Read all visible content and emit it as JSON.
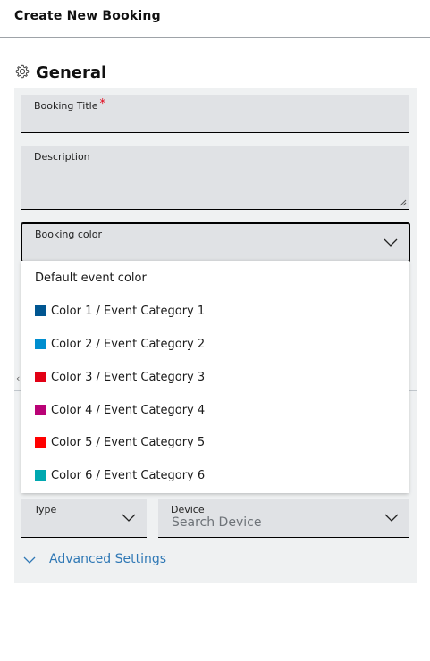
{
  "header": {
    "title": "Create New Booking"
  },
  "section": {
    "title": "General",
    "icon": "gear-icon"
  },
  "fields": {
    "booking_title": {
      "label": "Booking Title",
      "required_mark": "*"
    },
    "description": {
      "label": "Description"
    },
    "booking_color": {
      "label": "Booking color"
    },
    "type": {
      "label": "Type"
    },
    "device": {
      "label": "Device",
      "placeholder": "Search Device"
    }
  },
  "color_options": [
    {
      "label": "Default event color"
    },
    {
      "label": "Color 1 / Event Category 1",
      "color": "#005691"
    },
    {
      "label": "Color 2 / Event Category 2",
      "color": "#008ecf"
    },
    {
      "label": "Color 3 / Event Category 3",
      "color": "#e20015"
    },
    {
      "label": "Color 4 / Event Category 4",
      "color": "#b90276"
    },
    {
      "label": "Color 5 / Event Category 5",
      "color": "#ff0000"
    },
    {
      "label": "Color 6 / Event Category 6",
      "color": "#00a8b0"
    }
  ],
  "advanced": {
    "label": "Advanced Settings"
  },
  "colors": {
    "accent": "#2f78b5",
    "field_bg": "#e0e2e5",
    "panel_bg": "#eff1f2",
    "required": "#e20015"
  }
}
